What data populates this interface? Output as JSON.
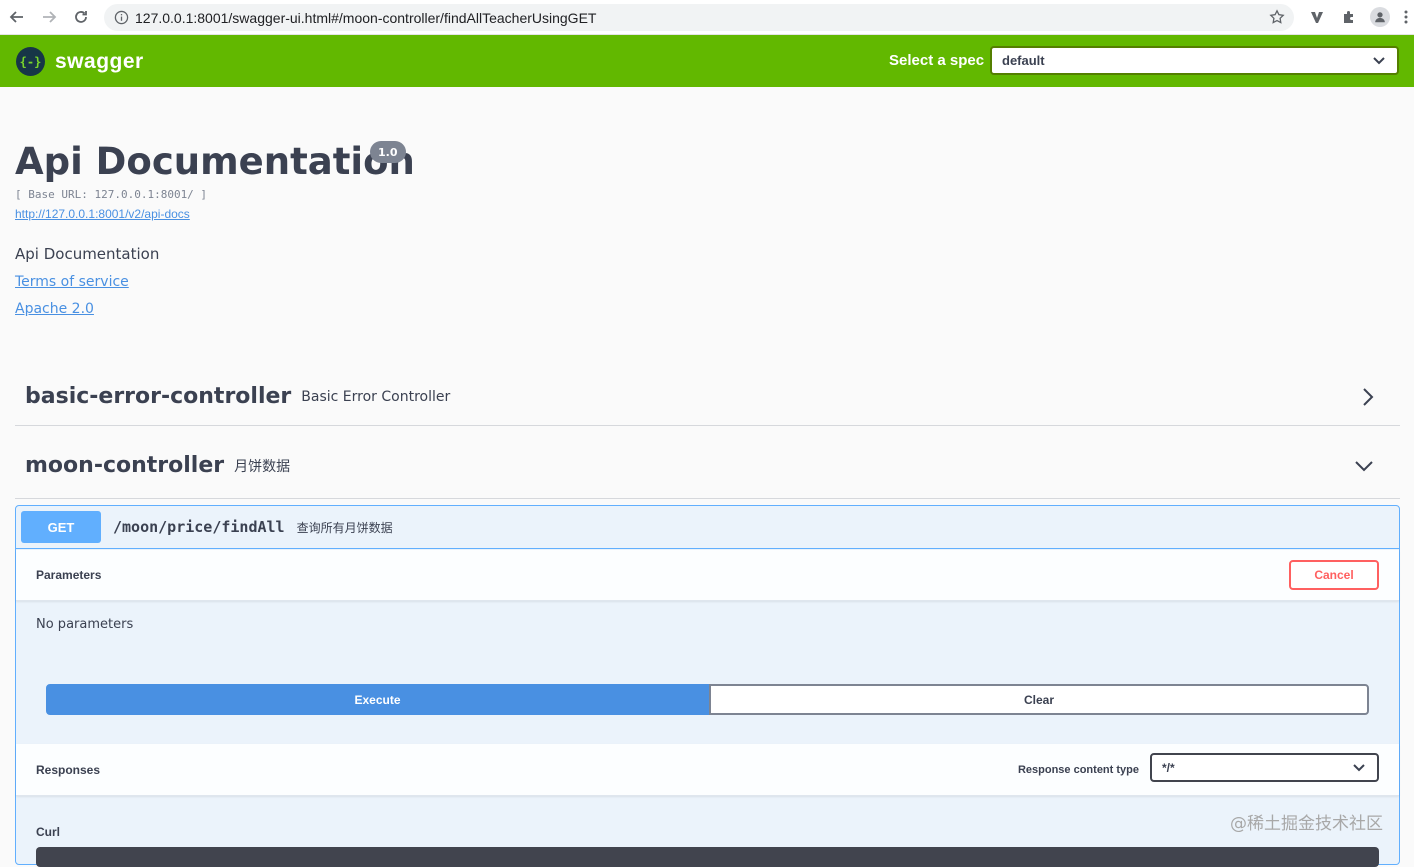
{
  "browser": {
    "url": "127.0.0.1:8001/swagger-ui.html#/moon-controller/findAllTeacherUsingGET"
  },
  "topbar": {
    "logo_text": "swagger",
    "logo_mark": "{-}",
    "spec_label": "Select a spec",
    "spec_value": "default"
  },
  "info": {
    "title": "Api Documentation",
    "version": "1.0",
    "base_url": "[ Base URL: 127.0.0.1:8001/ ]",
    "api_docs_link": "http://127.0.0.1:8001/v2/api-docs",
    "description": "Api Documentation",
    "terms_link": "Terms of service",
    "license_link": "Apache 2.0"
  },
  "tags": [
    {
      "name": "basic-error-controller",
      "description": "Basic Error Controller"
    },
    {
      "name": "moon-controller",
      "description": "月饼数据"
    }
  ],
  "operation": {
    "method": "GET",
    "path": "/moon/price/findAll",
    "summary": "查询所有月饼数据",
    "parameters_title": "Parameters",
    "cancel_label": "Cancel",
    "no_parameters": "No parameters",
    "execute_label": "Execute",
    "clear_label": "Clear",
    "responses_title": "Responses",
    "response_content_type_label": "Response content type",
    "response_content_type_value": "*/*",
    "curl_label": "Curl"
  },
  "watermark": "@稀土掘金技术社区",
  "colors": {
    "topbar": "#62b800",
    "get_method": "#61affe",
    "execute": "#4990e2",
    "cancel": "#ff6060",
    "link": "#4990e2"
  }
}
